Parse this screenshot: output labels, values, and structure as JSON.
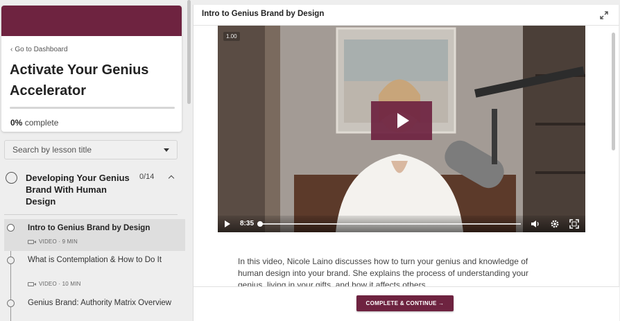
{
  "sidebar": {
    "back_link": "Go to Dashboard",
    "course_title": "Activate Your Genius Accelerator",
    "progress": {
      "percent_label": "0%",
      "suffix": "complete",
      "value": 0
    },
    "search": {
      "placeholder": "Search by lesson title"
    },
    "section": {
      "title": "Developing Your Genius Brand With Human Design",
      "count": "0/14"
    },
    "lessons": [
      {
        "title": "Intro to Genius Brand by Design",
        "meta": "VIDEO · 9 MIN",
        "active": true
      },
      {
        "title": "What is Contemplation & How to Do It",
        "meta": "VIDEO · 10 MIN",
        "active": false
      },
      {
        "title": "Genius Brand: Authority Matrix Overview",
        "meta": "",
        "active": false
      }
    ]
  },
  "main": {
    "lesson_heading": "Intro to Genius Brand by Design",
    "video": {
      "speed_badge": "1.00",
      "time": "8:35",
      "played_fraction": 0.0
    },
    "description": "In this video, Nicole Laino discusses how to turn your genius and knowledge of human design into your brand. She explains the process of understanding your genius, living in your gifts, and how it affects others.",
    "complete_button": "COMPLETE & CONTINUE →"
  },
  "colors": {
    "brand": "#6e2340",
    "sidebar_bg": "#eeeeee"
  }
}
